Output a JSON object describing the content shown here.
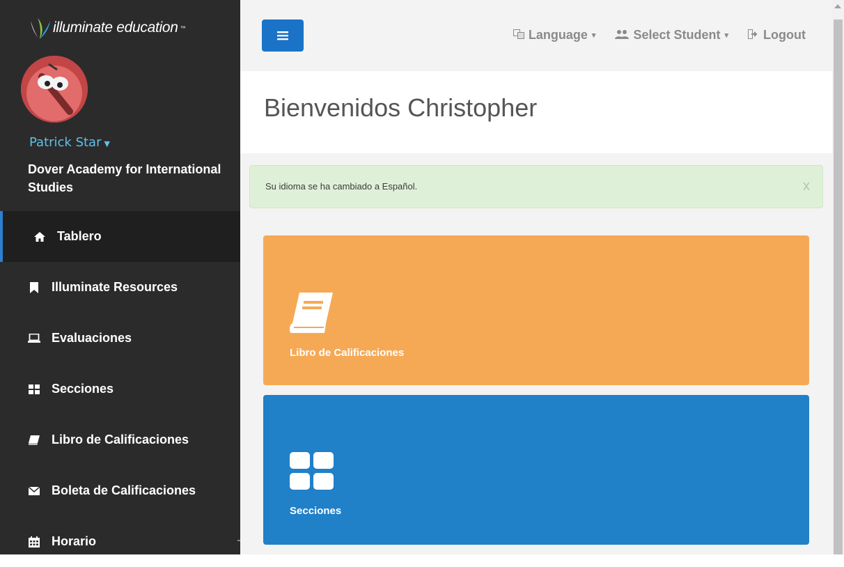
{
  "brand": {
    "name": "illuminate education",
    "tm": "™"
  },
  "user": {
    "name": "Patrick Star",
    "school": "Dover Academy for International Studies"
  },
  "nav": [
    {
      "label": "Tablero",
      "icon": "home-icon"
    },
    {
      "label": "Illuminate Resources",
      "icon": "bookmark-icon"
    },
    {
      "label": "Evaluaciones",
      "icon": "laptop-icon"
    },
    {
      "label": "Secciones",
      "icon": "grid-icon"
    },
    {
      "label": "Libro de Calificaciones",
      "icon": "book-icon"
    },
    {
      "label": "Boleta de Calificaciones",
      "icon": "envelope-icon"
    },
    {
      "label": "Horario",
      "icon": "calendar-icon"
    }
  ],
  "topbar": {
    "language": "Language",
    "select_student": "Select Student",
    "logout": "Logout"
  },
  "header": {
    "title": "Bienvenidos Christopher"
  },
  "alert": {
    "message": "Su idioma se ha cambiado a Español.",
    "close": "x"
  },
  "tiles": [
    {
      "label": "Libro de Calificaciones",
      "icon": "book-icon",
      "color": "#f6a955"
    },
    {
      "label": "Secciones",
      "icon": "grid-icon",
      "color": "#2080c8"
    }
  ],
  "colors": {
    "sidebar": "#2b2b2b",
    "accent": "#1a73c6",
    "user_link": "#5ec1ec",
    "alert_bg": "#dff0d8"
  }
}
